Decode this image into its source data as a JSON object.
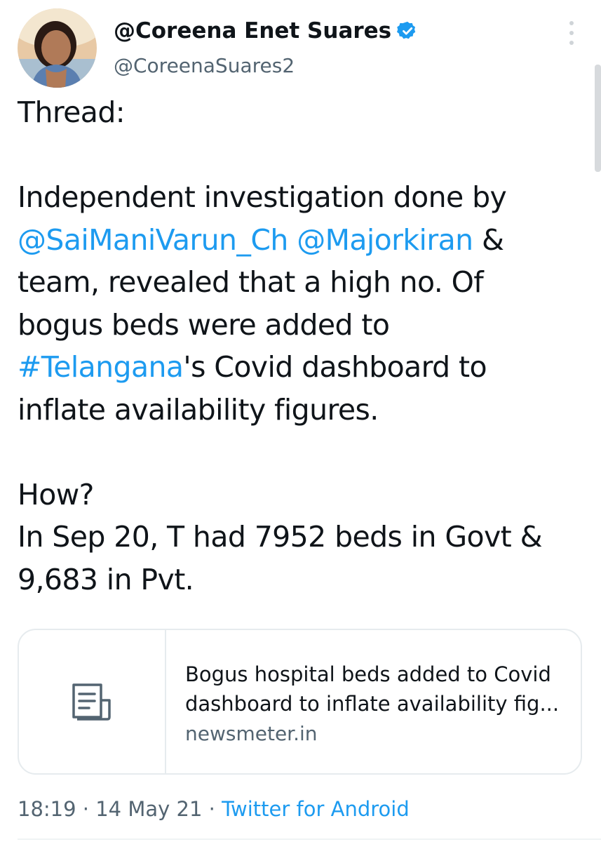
{
  "author": {
    "display_name": "@Coreena Enet Suares",
    "handle": "@CoreenaSuares2"
  },
  "tweet": {
    "line_1": "Thread:",
    "line_2": "Independent investigation done by",
    "mention_1": "@SaiManiVarun_Ch",
    "mention_2": "@Majorkiran",
    "line_3_rest": " &",
    "line_4": "team, revealed that a high no. Of",
    "line_5": "bogus beds were added to",
    "hashtag": "#Telangana",
    "line_6_rest": "'s Covid dashboard to",
    "line_7": "inflate availability figures.",
    "line_8": "How?",
    "line_9": "In Sep 20, T had 7952 beds in Govt &",
    "line_10": "9,683 in Pvt."
  },
  "link_card": {
    "title_line_1": "Bogus hospital beds added to Covid",
    "title_line_2": "dashboard to inflate availability fig...",
    "domain": "newsmeter.in",
    "icon": "article-icon"
  },
  "meta": {
    "time": "18:19",
    "date": "14 May 21",
    "separator": "·",
    "source": "Twitter for Android"
  },
  "icons": {
    "verified": "verified-badge-icon",
    "more": "more-options-icon"
  },
  "colors": {
    "link": "#1d9bf0",
    "secondary_text": "#536471",
    "primary_text": "#0f1419",
    "border": "#e6ebee"
  }
}
